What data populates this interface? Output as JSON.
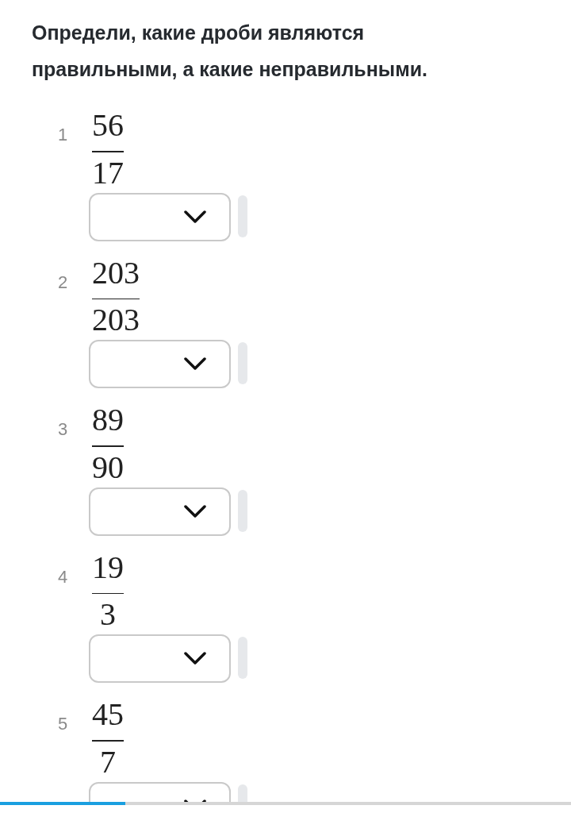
{
  "instruction": "Определи, какие дроби являются правильными, а какие неправильными.",
  "items": [
    {
      "number": "1",
      "numerator": "56",
      "denominator": "17",
      "dropdown": {
        "expanded": false
      }
    },
    {
      "number": "2",
      "numerator": "203",
      "denominator": "203",
      "dropdown": {
        "expanded": false
      }
    },
    {
      "number": "3",
      "numerator": "89",
      "denominator": "90",
      "dropdown": {
        "expanded": false
      }
    },
    {
      "number": "4",
      "numerator": "19",
      "denominator": "3",
      "dropdown": {
        "expanded": false
      }
    },
    {
      "number": "5",
      "numerator": "45",
      "denominator": "7",
      "dropdown": {
        "expanded": false
      }
    }
  ],
  "progress": {
    "level": 0.22
  }
}
